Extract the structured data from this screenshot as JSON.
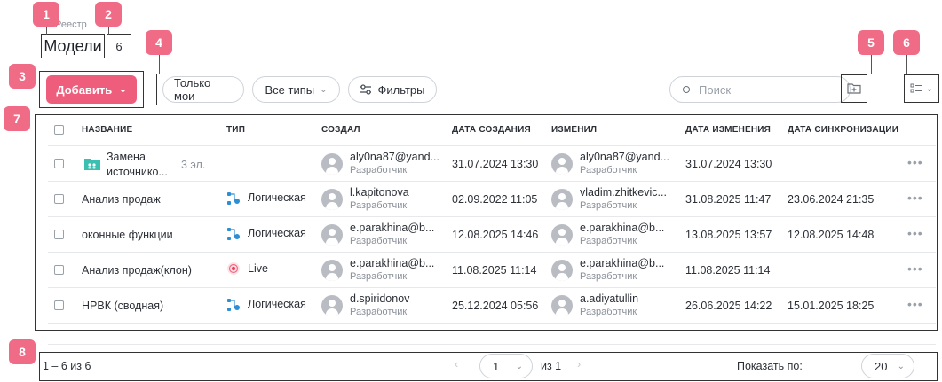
{
  "breadcrumb": "Реестр",
  "page_title": "Модели",
  "page_count": "6",
  "add_button": {
    "label": "Добавить",
    "color": "#ee5e7c"
  },
  "filters": {
    "only_mine": "Только мои",
    "all_types": "Все типы",
    "filters": "Фильтры"
  },
  "search": {
    "placeholder": "Поиск"
  },
  "callouts": [
    "1",
    "2",
    "3",
    "4",
    "5",
    "6",
    "7",
    "8"
  ],
  "callout_color": "#f06b86",
  "table": {
    "columns": [
      "НАЗВАНИЕ",
      "ТИП",
      "СОЗДАЛ",
      "ДАТА СОЗДАНИЯ",
      "ИЗМЕНИЛ",
      "ДАТА ИЗМЕНЕНИЯ",
      "ДАТА СИНХРОНИЗАЦИИ"
    ],
    "rows": [
      {
        "name": "Замена источнико...",
        "elements": "3 эл.",
        "type": "",
        "type_icon": "folder-icon",
        "created_by": "aly0na87@yand...",
        "created_role": "Разработчик",
        "created_date": "31.07.2024 13:30",
        "modified_by": "aly0na87@yand...",
        "modified_role": "Разработчик",
        "modified_date": "31.07.2024 13:30",
        "sync_date": ""
      },
      {
        "name": "Анализ продаж",
        "elements": "",
        "type": "Логическая",
        "type_icon": "logical-model-icon",
        "created_by": "l.kapitonova",
        "created_role": "Разработчик",
        "created_date": "02.09.2022 11:05",
        "modified_by": "vladim.zhitkevic...",
        "modified_role": "Разработчик",
        "modified_date": "31.08.2025 11:47",
        "sync_date": "23.06.2024 21:35"
      },
      {
        "name": "оконные функции",
        "elements": "",
        "type": "Логическая",
        "type_icon": "logical-model-icon",
        "created_by": "e.parakhina@b...",
        "created_role": "Разработчик",
        "created_date": "12.08.2025 14:46",
        "modified_by": "e.parakhina@b...",
        "modified_role": "Разработчик",
        "modified_date": "13.08.2025 13:57",
        "sync_date": "12.08.2025 14:48"
      },
      {
        "name": "Анализ продаж(клон)",
        "elements": "",
        "type": "Live",
        "type_icon": "live-model-icon",
        "created_by": "e.parakhina@b...",
        "created_role": "Разработчик",
        "created_date": "11.08.2025 11:14",
        "modified_by": "e.parakhina@b...",
        "modified_role": "Разработчик",
        "modified_date": "11.08.2025 11:14",
        "sync_date": ""
      },
      {
        "name": "НРВК (сводная)",
        "elements": "",
        "type": "Логическая",
        "type_icon": "logical-model-icon",
        "created_by": "d.spiridonov",
        "created_role": "Разработчик",
        "created_date": "25.12.2024 05:56",
        "modified_by": "a.adiyatullin",
        "modified_role": "Разработчик",
        "modified_date": "26.06.2025 14:22",
        "sync_date": "15.01.2025 18:25"
      }
    ]
  },
  "pagination": {
    "range": "1 – 6 из 6",
    "page": "1",
    "of": "из 1",
    "per_page_label": "Показать по:",
    "per_page": "20"
  }
}
